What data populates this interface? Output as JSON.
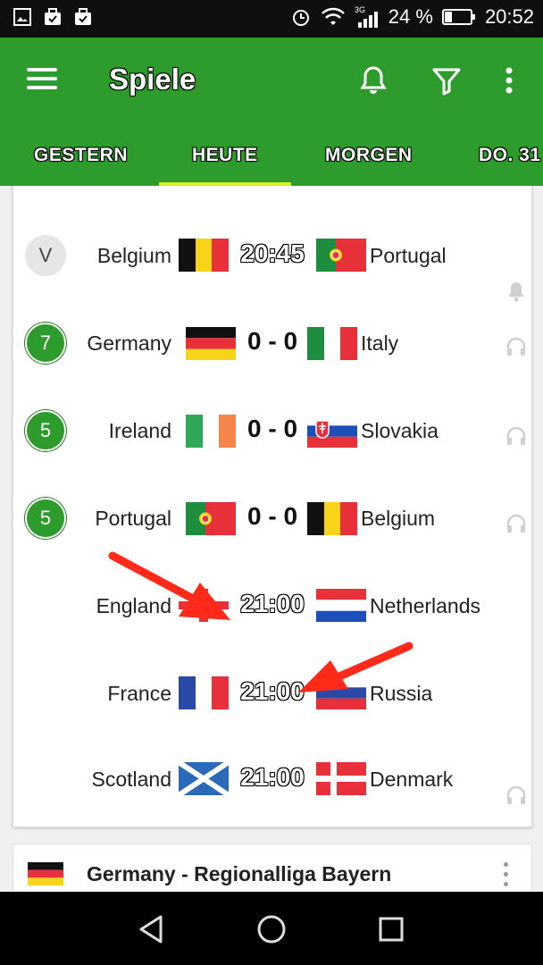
{
  "status_bar": {
    "battery": "24 %",
    "time": "20:52",
    "network": "3G"
  },
  "app_bar": {
    "title": "Spiele"
  },
  "tabs": [
    {
      "label": "GESTERN"
    },
    {
      "label": "HEUTE"
    },
    {
      "label": "MORGEN"
    },
    {
      "label": "DO. 31"
    }
  ],
  "matches": [
    {
      "badge": "V",
      "home": "Belgium",
      "away": "Portugal",
      "center": "20:45",
      "home_flag": "belgium-flag",
      "away_flag": "portugal-flag"
    },
    {
      "badge": "7",
      "home": "Germany",
      "away": "Italy",
      "center": "0 - 0",
      "home_flag": "germany-flag",
      "away_flag": "italy-flag"
    },
    {
      "badge": "5",
      "home": "Ireland",
      "away": "Slovakia",
      "center": "0 - 0",
      "home_flag": "ireland-flag",
      "away_flag": "slovakia-flag"
    },
    {
      "badge": "5",
      "home": "Portugal",
      "away": "Belgium",
      "center": "0 - 0",
      "home_flag": "portugal-flag",
      "away_flag": "belgium-flag"
    },
    {
      "badge": "",
      "home": "England",
      "away": "Netherlands",
      "center": "21:00",
      "home_flag": "england-flag",
      "away_flag": "netherlands-flag"
    },
    {
      "badge": "",
      "home": "France",
      "away": "Russia",
      "center": "21:00",
      "home_flag": "france-flag",
      "away_flag": "russia-flag"
    },
    {
      "badge": "",
      "home": "Scotland",
      "away": "Denmark",
      "center": "21:00",
      "home_flag": "scotland-flag",
      "away_flag": "denmark-flag"
    }
  ],
  "next_league": {
    "name": "Germany - Regionalliga Bayern",
    "flag": "germany-flag"
  },
  "colors": {
    "app_green": "#2d9c2d",
    "tab_indicator": "#d7f021",
    "arrow_red": "#ff2a1a"
  }
}
